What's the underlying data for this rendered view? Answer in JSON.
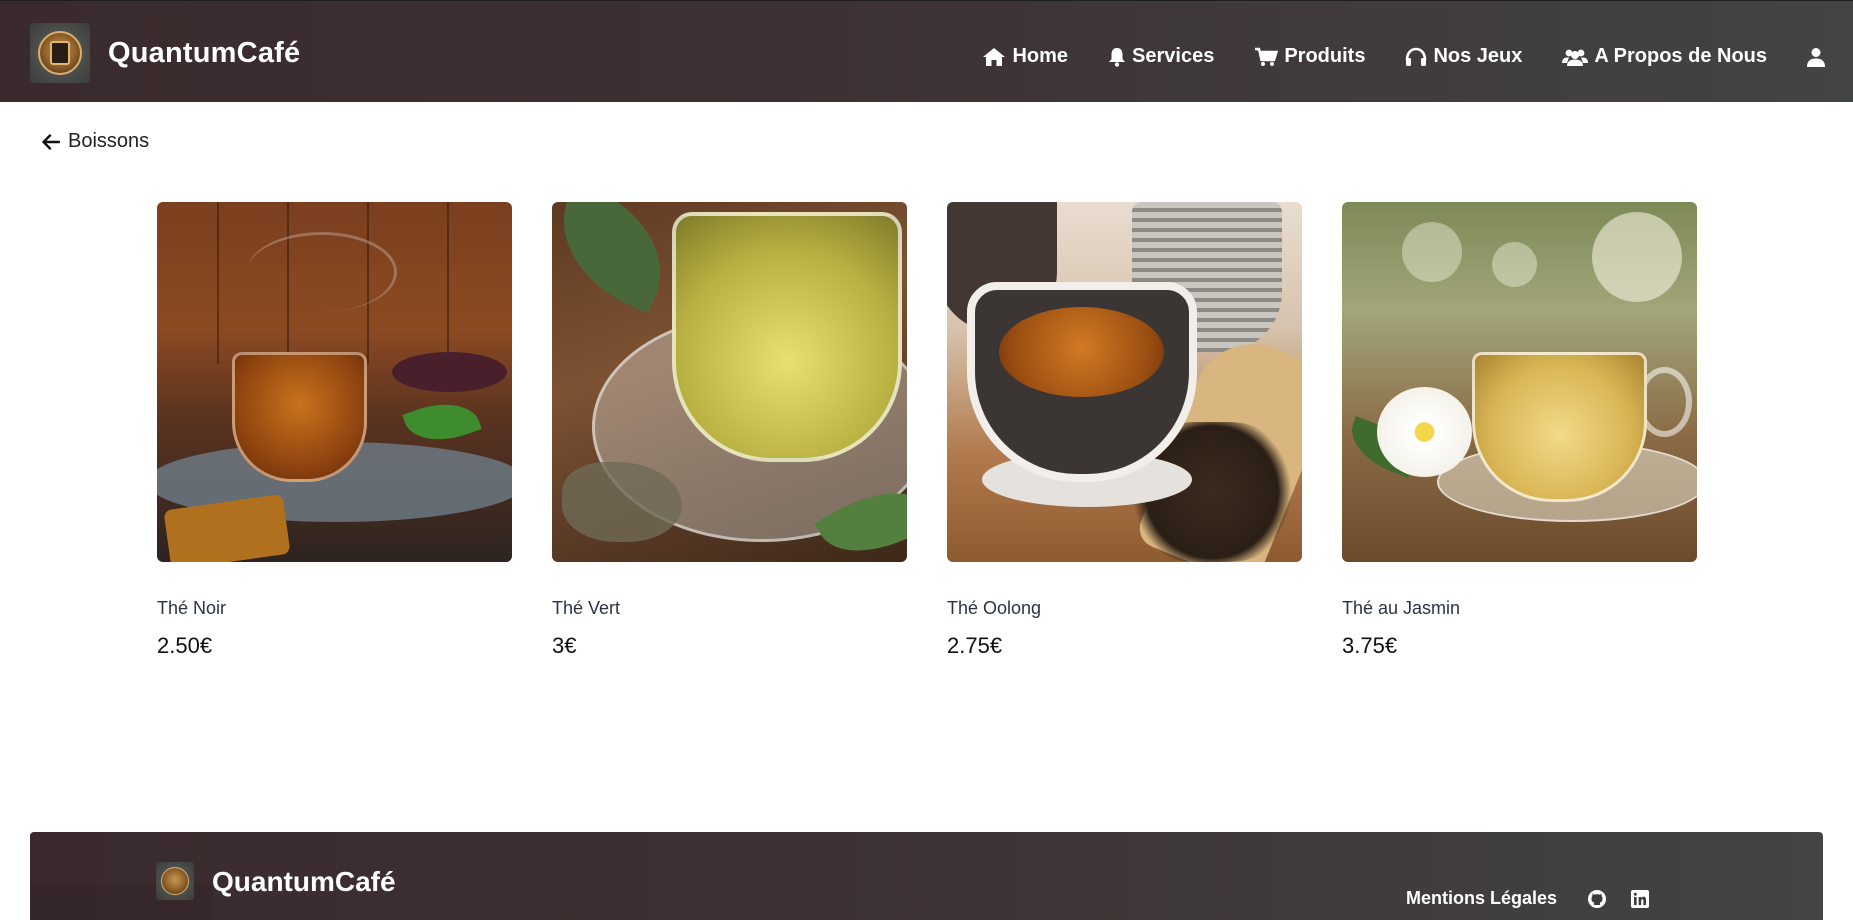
{
  "header": {
    "brand": "QuantumCafé",
    "nav": [
      {
        "label": "Home",
        "icon": "home-icon"
      },
      {
        "label": "Services",
        "icon": "bell-icon"
      },
      {
        "label": "Produits",
        "icon": "cart-icon"
      },
      {
        "label": "Nos Jeux",
        "icon": "headphones-icon"
      },
      {
        "label": "A Propos de Nous",
        "icon": "users-icon"
      }
    ],
    "user_icon": "user-icon"
  },
  "back_link": {
    "label": "Boissons",
    "icon": "arrow-left-icon"
  },
  "products": [
    {
      "name": "Thé Noir",
      "price": "2.50€",
      "image": "black-tea-photo"
    },
    {
      "name": "Thé Vert",
      "price": "3€",
      "image": "green-tea-photo"
    },
    {
      "name": "Thé Oolong",
      "price": "2.75€",
      "image": "oolong-tea-photo"
    },
    {
      "name": "Thé au Jasmin",
      "price": "3.75€",
      "image": "jasmine-tea-photo"
    }
  ],
  "footer": {
    "brand": "QuantumCafé",
    "legal": "Mentions Légales",
    "icons": [
      "github-icon",
      "linkedin-icon"
    ]
  },
  "colors": {
    "header_bg_start": "#3a2a2d",
    "header_bg_end": "#434444",
    "text_white": "#ffffff",
    "product_name": "#2d3245"
  }
}
